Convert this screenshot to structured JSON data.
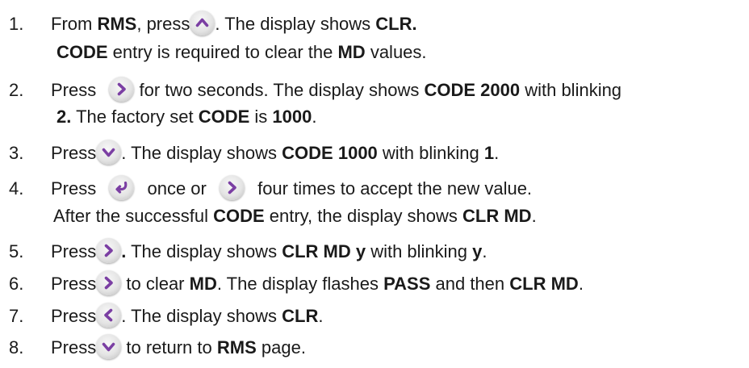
{
  "icons": {
    "up": "chevron-up-icon",
    "right": "chevron-right-icon",
    "down": "chevron-down-icon",
    "left": "chevron-left-icon",
    "enter": "enter-return-icon",
    "accent": "#7b3fa3"
  },
  "steps": [
    {
      "num": "1.",
      "a": "From ",
      "b": "RMS",
      "c": ", press",
      "d": ". The display shows ",
      "e": "CLR.",
      "cont": {
        "a": "CODE",
        "b": " entry is required to clear the ",
        "c": "MD",
        "d": " values."
      }
    },
    {
      "num": "2.",
      "a": "Press ",
      "b": " for two seconds. The display shows ",
      "c": "CODE 2000",
      "d": " with blinking",
      "cont": {
        "a": "2.",
        "b": " The factory set ",
        "c": "CODE",
        "d": " is ",
        "e": "1000",
        "f": "."
      }
    },
    {
      "num": "3.",
      "a": "Press",
      "b": ". The display shows ",
      "c": "CODE 1000",
      "d": " with blinking ",
      "e": "1",
      "f": "."
    },
    {
      "num": "4.",
      "a": "Press ",
      "b": " once or ",
      "c": " four times to accept the new value.",
      "cont": {
        "a": "After the successful ",
        "b": "CODE",
        "c": " entry, the display shows ",
        "d": "CLR MD",
        "e": "."
      }
    },
    {
      "num": "5.",
      "a": "Press",
      "b": ".",
      "c": " The display shows ",
      "d": "CLR MD y",
      "e": " with blinking ",
      "f": "y",
      "g": "."
    },
    {
      "num": "6.",
      "a": "Press",
      "b": " to clear ",
      "c": "MD",
      "d": ". The display flashes ",
      "e": "PASS",
      "f": " and then ",
      "g": "CLR MD",
      "h": "."
    },
    {
      "num": "7.",
      "a": "Press",
      "b": ". The display shows ",
      "c": "CLR",
      "d": "."
    },
    {
      "num": "8.",
      "a": "Press",
      "b": " to return to ",
      "c": "RMS",
      "d": " page."
    }
  ]
}
